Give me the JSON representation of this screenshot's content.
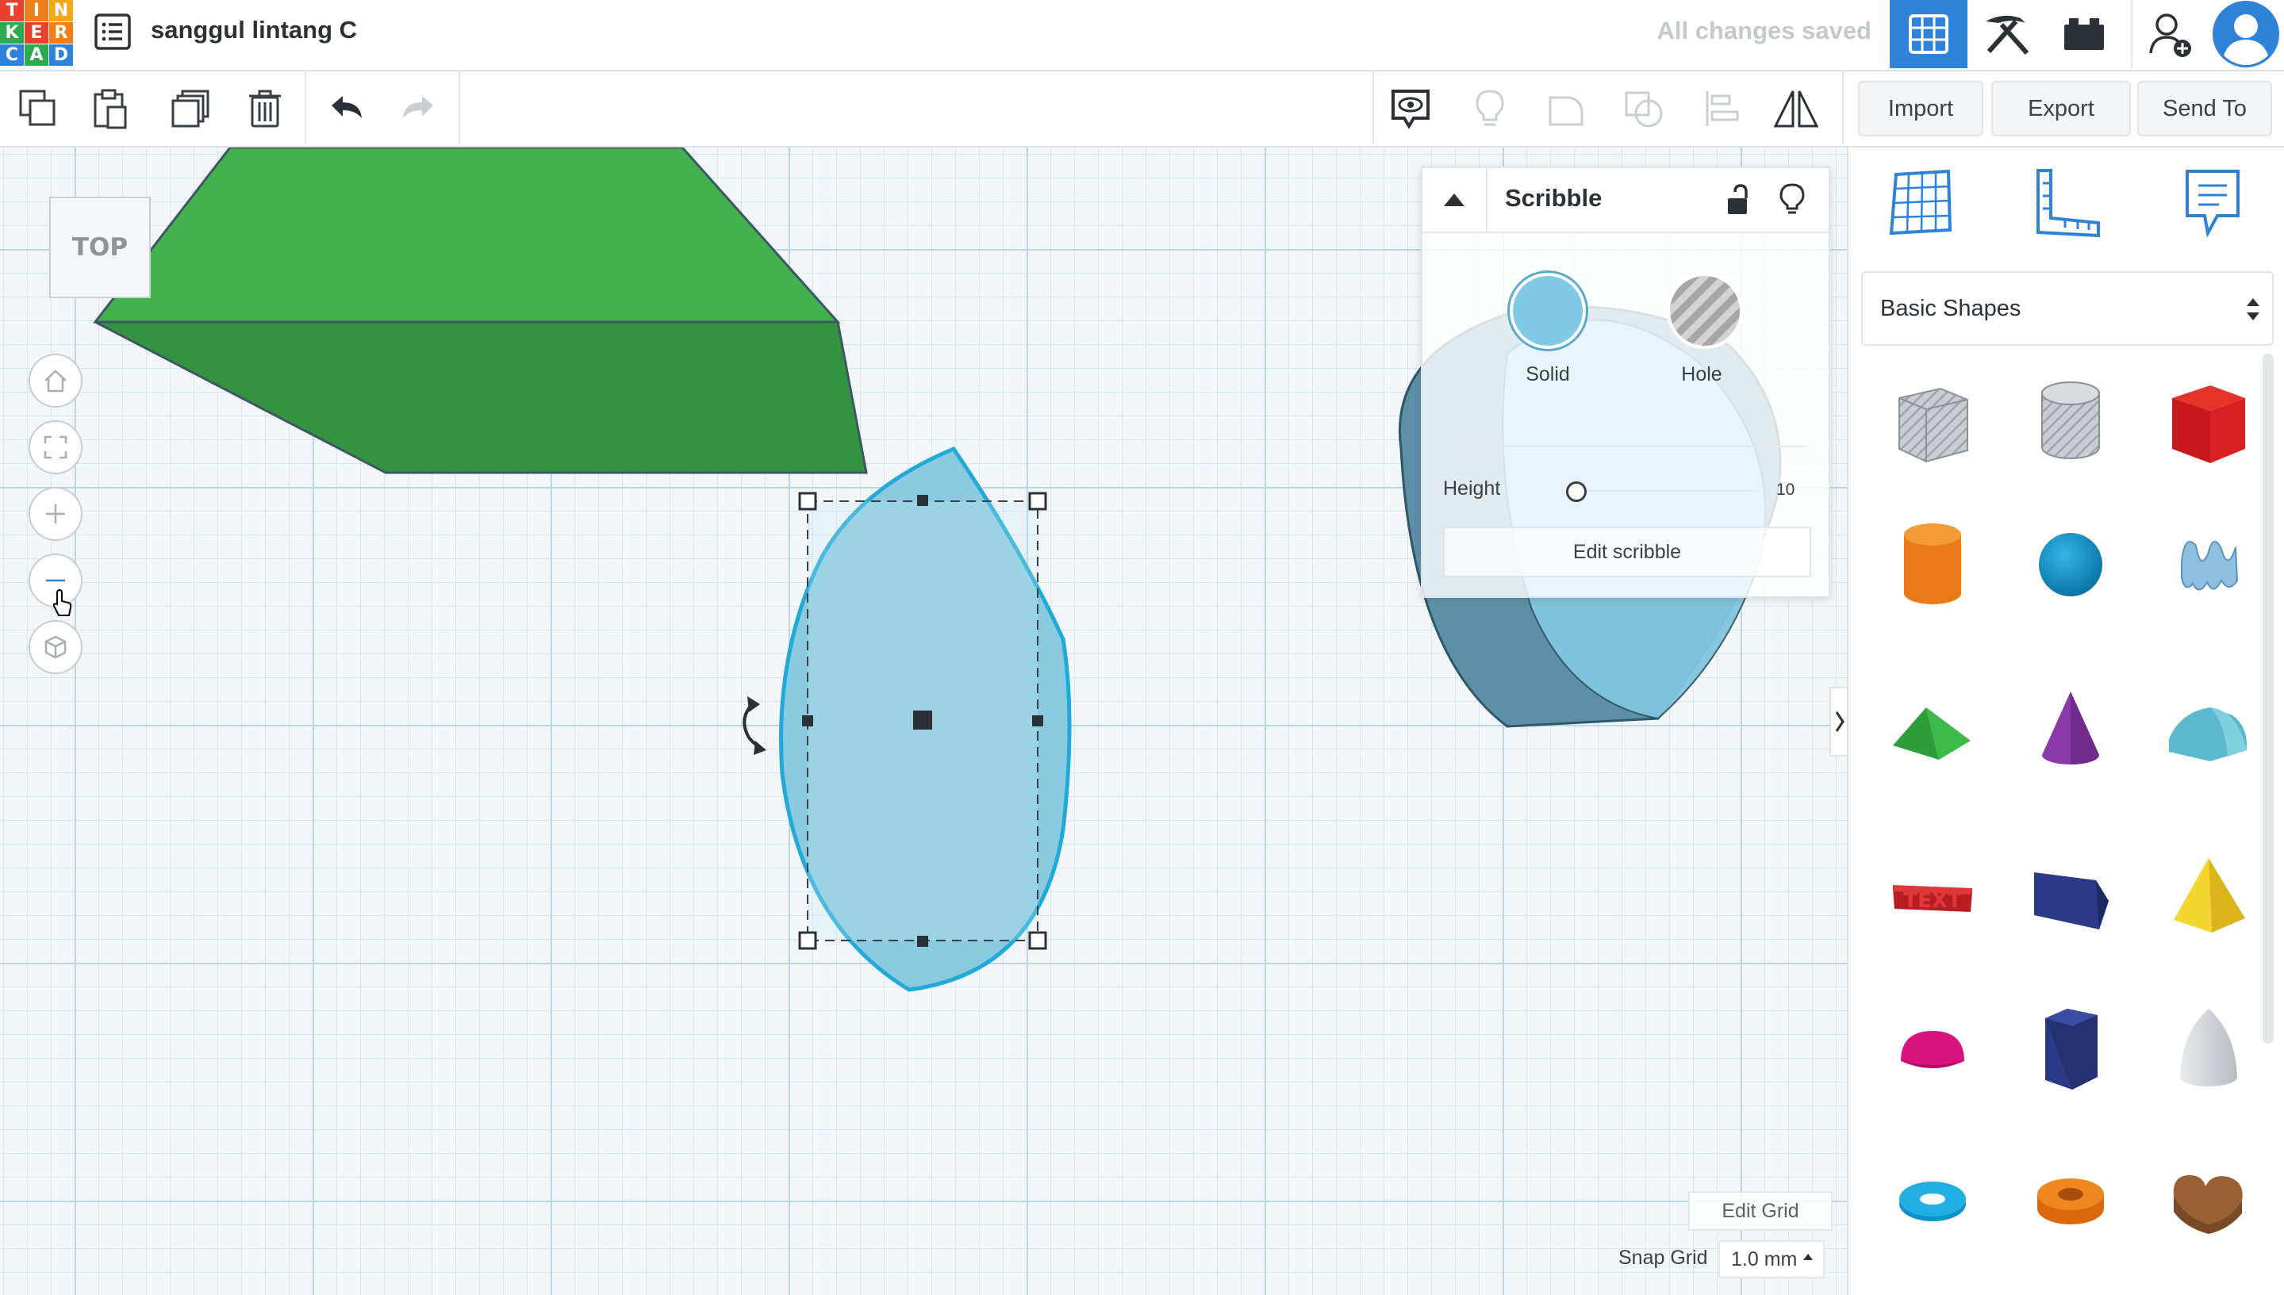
{
  "logo": {
    "letters": [
      "T",
      "I",
      "N",
      "K",
      "E",
      "R",
      "C",
      "A",
      "D"
    ],
    "colors": [
      "#e8422f",
      "#ef7f1a",
      "#f3a81a",
      "#2da94f",
      "#e8422f",
      "#ef7f1a",
      "#2e83d8",
      "#2da94f",
      "#2e83d8"
    ]
  },
  "header": {
    "project_title": "sanggul lintang C",
    "save_status": "All changes saved"
  },
  "toolbar": {
    "import_label": "Import",
    "export_label": "Export",
    "send_to_label": "Send To"
  },
  "workplane": {
    "view_cube_label": "TOP"
  },
  "inspector": {
    "title": "Scribble",
    "solid_label": "Solid",
    "hole_label": "Hole",
    "height_label": "Height",
    "height_value": "10",
    "edit_button": "Edit scribble"
  },
  "grid": {
    "edit_grid_label": "Edit Grid",
    "snap_label": "Snap Grid",
    "snap_value": "1.0 mm"
  },
  "shapes_panel": {
    "category": "Basic Shapes",
    "items": [
      "Box Hole",
      "Cylinder Hole",
      "Box",
      "Cylinder",
      "Sphere",
      "Scribble",
      "Roof",
      "Cone",
      "Round Roof",
      "Text",
      "Wedge",
      "Pyramid",
      "Half Sphere",
      "Polygon",
      "Paraboloid",
      "Torus",
      "Tube",
      "Heart"
    ]
  },
  "colors": {
    "accent": "#2e83d8",
    "selected_shape": "#8ccbdf",
    "green_shape": "#3fae4c"
  }
}
